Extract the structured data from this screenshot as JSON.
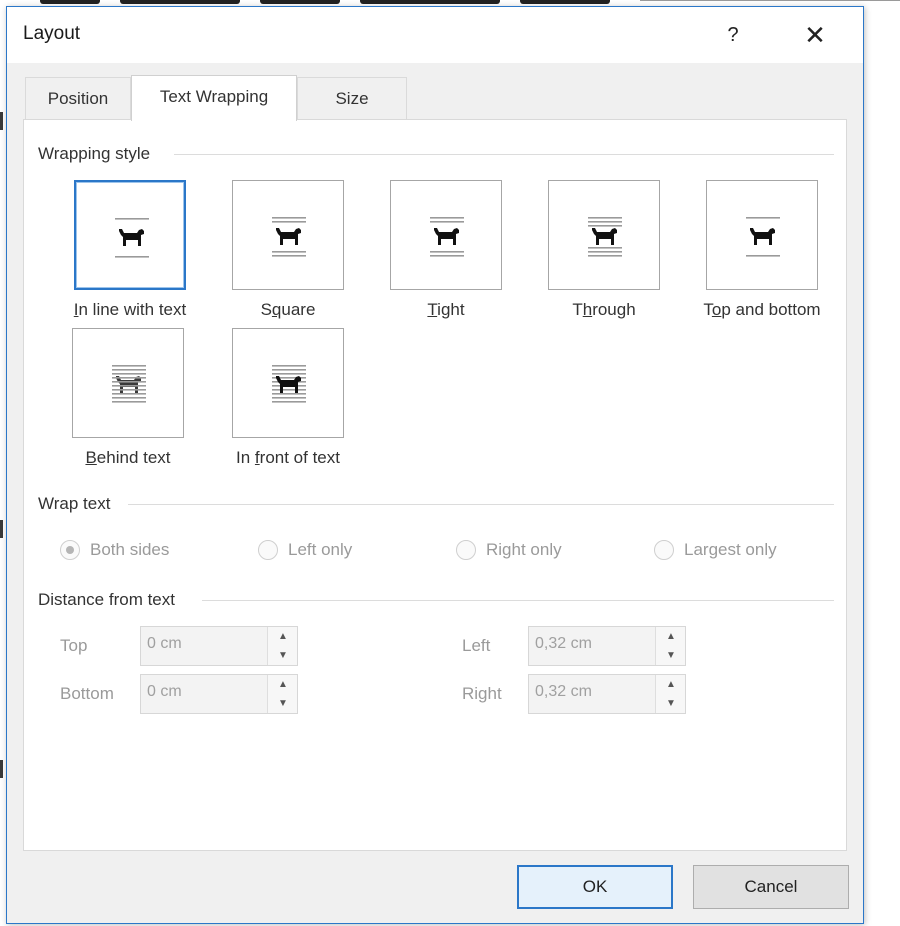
{
  "dialog": {
    "title": "Layout",
    "help_label": "?",
    "close_label": "✕"
  },
  "tabs": [
    {
      "label": "Position",
      "active": false
    },
    {
      "label": "Text Wrapping",
      "active": true
    },
    {
      "label": "Size",
      "active": false
    }
  ],
  "wrapping_style": {
    "heading": "Wrapping style",
    "options": [
      {
        "label": "In line with text",
        "accel": "I",
        "rest": "n line with text",
        "selected": true
      },
      {
        "label": "Square",
        "pre": "S",
        "accel": "q",
        "rest": "uare",
        "selected": false
      },
      {
        "label": "Tight",
        "accel": "T",
        "rest": "ight",
        "selected": false
      },
      {
        "label": "Through",
        "pre": "T",
        "accel": "h",
        "rest": "rough",
        "selected": false
      },
      {
        "label": "Top and bottom",
        "pre": "T",
        "accel": "o",
        "rest": "p and bottom",
        "selected": false
      },
      {
        "label": "Behind text",
        "accel": "B",
        "rest": "ehind text",
        "selected": false
      },
      {
        "label": "In front of text",
        "pre": "In ",
        "accel": "f",
        "rest": "ront of text",
        "selected": false
      }
    ]
  },
  "wrap_text": {
    "heading": "Wrap text",
    "options": [
      {
        "label": "Both sides",
        "checked": true
      },
      {
        "label": "Left only",
        "checked": false
      },
      {
        "label": "Right only",
        "checked": false
      },
      {
        "label": "Largest only",
        "checked": false
      }
    ]
  },
  "distance": {
    "heading": "Distance from text",
    "top": {
      "label": "Top",
      "value": "0 cm"
    },
    "bottom": {
      "label": "Bottom",
      "value": "0 cm"
    },
    "left": {
      "label": "Left",
      "value": "0,32 cm"
    },
    "right": {
      "label": "Right",
      "value": "0,32 cm"
    }
  },
  "buttons": {
    "ok": "OK",
    "cancel": "Cancel"
  },
  "colors": {
    "accent": "#2b77c8",
    "dialog_bg": "#f0f0f0",
    "panel_bg": "#ffffff",
    "disabled_text": "#9a9a9a"
  }
}
